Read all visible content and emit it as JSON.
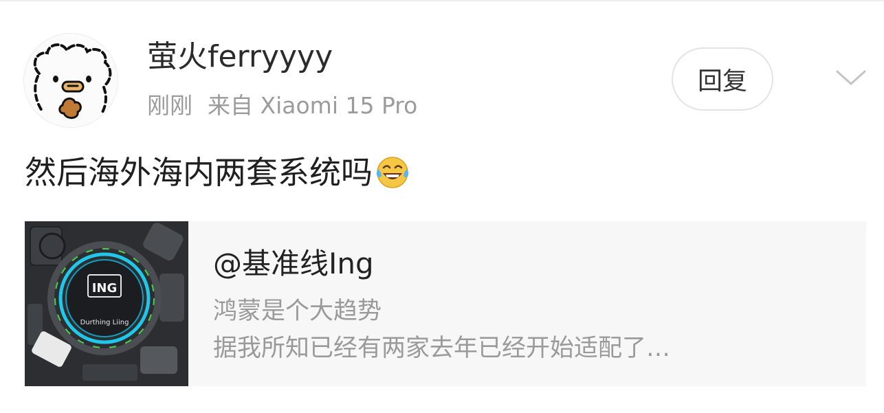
{
  "comment": {
    "username": "萤火ferryyyy",
    "time": "刚刚",
    "source": "来自 Xiaomi 15 Pro",
    "reply_label": "回复",
    "text": "然后海外海内两套系统吗",
    "emoji": "laughing-tears-emoji"
  },
  "quoted_post": {
    "author": "@基准线Ing",
    "line1": "鸿蒙是个大趋势",
    "line2": "据我所知已经有两家去年已经开始适配了…",
    "thumbnail_texts": [
      "ING",
      "Durthing Liing"
    ]
  },
  "colors": {
    "username": "#2b2b2b",
    "meta": "#9b9b9b",
    "card_bg": "#f7f7f7",
    "reply_border": "#e3e3e3"
  }
}
